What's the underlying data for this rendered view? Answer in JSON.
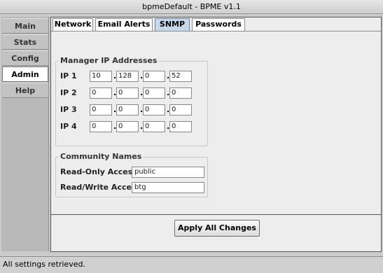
{
  "window": {
    "title": "bpmeDefault - BPME v1.1"
  },
  "sidebar": {
    "items": [
      {
        "label": "Main"
      },
      {
        "label": "Stats"
      },
      {
        "label": "Config"
      },
      {
        "label": "Admin"
      },
      {
        "label": "Help"
      }
    ],
    "active": "Admin"
  },
  "tabs": {
    "items": [
      {
        "label": "Network"
      },
      {
        "label": "Email Alerts"
      },
      {
        "label": "SNMP"
      },
      {
        "label": "Passwords"
      }
    ],
    "active": "SNMP"
  },
  "manager": {
    "title": "Manager IP Addresses",
    "rows": [
      {
        "label": "IP 1",
        "octets": [
          "10",
          "128",
          "0",
          "52"
        ]
      },
      {
        "label": "IP 2",
        "octets": [
          "0",
          "0",
          "0",
          "0"
        ]
      },
      {
        "label": "IP 3",
        "octets": [
          "0",
          "0",
          "0",
          "0"
        ]
      },
      {
        "label": "IP 4",
        "octets": [
          "0",
          "0",
          "0",
          "0"
        ]
      }
    ]
  },
  "community": {
    "title": "Community Names",
    "read_only_label": "Read-Only Access",
    "read_only_value": "public",
    "read_write_label": "Read/Write Access",
    "read_write_value": "btg"
  },
  "apply_label": "Apply All Changes",
  "status": {
    "text": "All settings retrieved."
  }
}
